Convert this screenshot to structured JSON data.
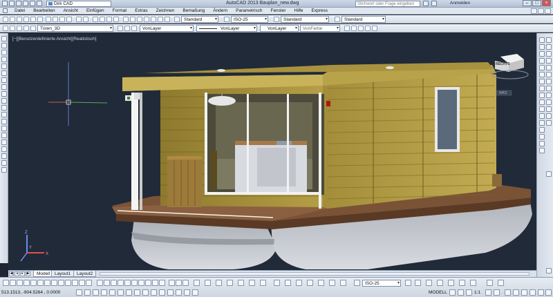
{
  "titlebar": {
    "workspace": "Dirk CAD",
    "title": "AutoCAD 2013   Bauplan_new.dwg",
    "search_placeholder": "Stichwort oder Frage eingeben",
    "login": "Anmelden"
  },
  "menu": [
    "Datei",
    "Bearbeiten",
    "Ansicht",
    "Einfügen",
    "Format",
    "Extras",
    "Zeichnen",
    "Bemaßung",
    "Ändern",
    "Parametrisch",
    "Fenster",
    "Hilfe",
    "Express"
  ],
  "styles_toolbar": {
    "text_style": "Standard",
    "dim_style": "ISO-25",
    "table_style": "Standard",
    "mleader_style": "Standard"
  },
  "layers_toolbar": {
    "layer": "Türen_3D",
    "color": "VonLayer",
    "linetype": "VonLayer",
    "lineweight": "VonLayer",
    "plotstyle": "VonFarbe"
  },
  "viewport": {
    "label": "[−][Benutzerdefinierte Ansicht][Realistisch]",
    "viewcube_face": "RECHTS",
    "wcs": "WKS"
  },
  "tabs": [
    "Modell",
    "Layout1",
    "Layout2"
  ],
  "status": {
    "coords": "513.1513,  -904.5264 , 0.0000",
    "dim_style": "ISO-25",
    "model": "MODELL",
    "scale": "1:1"
  },
  "colors": {
    "viewport_bg": "#212a38",
    "wood": "#a88f3a",
    "hull": "#c4c8cf",
    "deck": "#6e4a30"
  }
}
